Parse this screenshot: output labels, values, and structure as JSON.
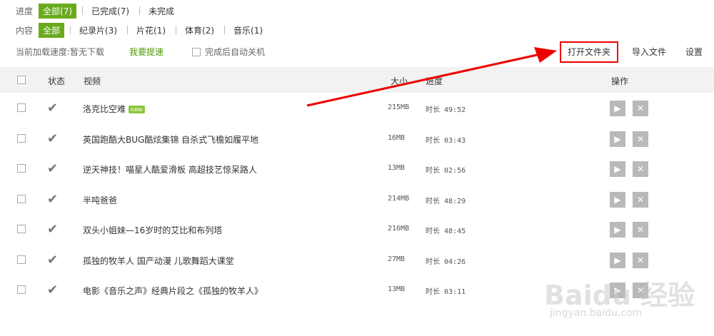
{
  "filters": {
    "progress": {
      "label": "进度",
      "options": [
        {
          "label": "全部(7)",
          "active": true
        },
        {
          "label": "已完成(7)",
          "active": false
        },
        {
          "label": "未完成",
          "active": false
        }
      ]
    },
    "content": {
      "label": "内容",
      "options": [
        {
          "label": "全部",
          "active": true
        },
        {
          "label": "纪录片(3)",
          "active": false
        },
        {
          "label": "片花(1)",
          "active": false
        },
        {
          "label": "体育(2)",
          "active": false
        },
        {
          "label": "音乐(1)",
          "active": false
        }
      ]
    }
  },
  "status_bar": {
    "speed_text": "当前加载速度:暂无下载",
    "speedup_label": "我要提速",
    "autoshutdown_label": "完成后自动关机"
  },
  "toolbar": {
    "open_folder": "打开文件夹",
    "import_file": "导入文件",
    "settings": "设置"
  },
  "table": {
    "headers": {
      "status": "状态",
      "video": "视频",
      "size": "大小",
      "progress": "进度",
      "actions": "操作"
    },
    "rows": [
      {
        "title": "洛克比空难",
        "badge": "new",
        "size": "215MB",
        "duration": "时长 49:52"
      },
      {
        "title": "英国跑酷大BUG酷炫集锦 自杀式飞檐如履平地",
        "badge": "",
        "size": "16MB",
        "duration": "时长 03:43"
      },
      {
        "title": "逆天神技！喵星人酷爱滑板 高超技艺惊呆路人",
        "badge": "",
        "size": "13MB",
        "duration": "时长 02:56"
      },
      {
        "title": "半吨爸爸",
        "badge": "",
        "size": "214MB",
        "duration": "时长 48:29"
      },
      {
        "title": "双头小姐妹—16岁时的艾比和布列塔",
        "badge": "",
        "size": "216MB",
        "duration": "时长 48:45"
      },
      {
        "title": "孤独的牧羊人 国产动漫 儿歌舞蹈大课堂",
        "badge": "",
        "size": "27MB",
        "duration": "时长 04:26"
      },
      {
        "title": "电影《音乐之声》经典片段之《孤独的牧羊人》",
        "badge": "",
        "size": "13MB",
        "duration": "时长 03:11"
      }
    ]
  },
  "watermark": {
    "brand": "Baidu 经验",
    "url": "jingyan.baidu.com"
  },
  "colors": {
    "accent": "#6aaa1d",
    "highlight": "#e00000"
  }
}
